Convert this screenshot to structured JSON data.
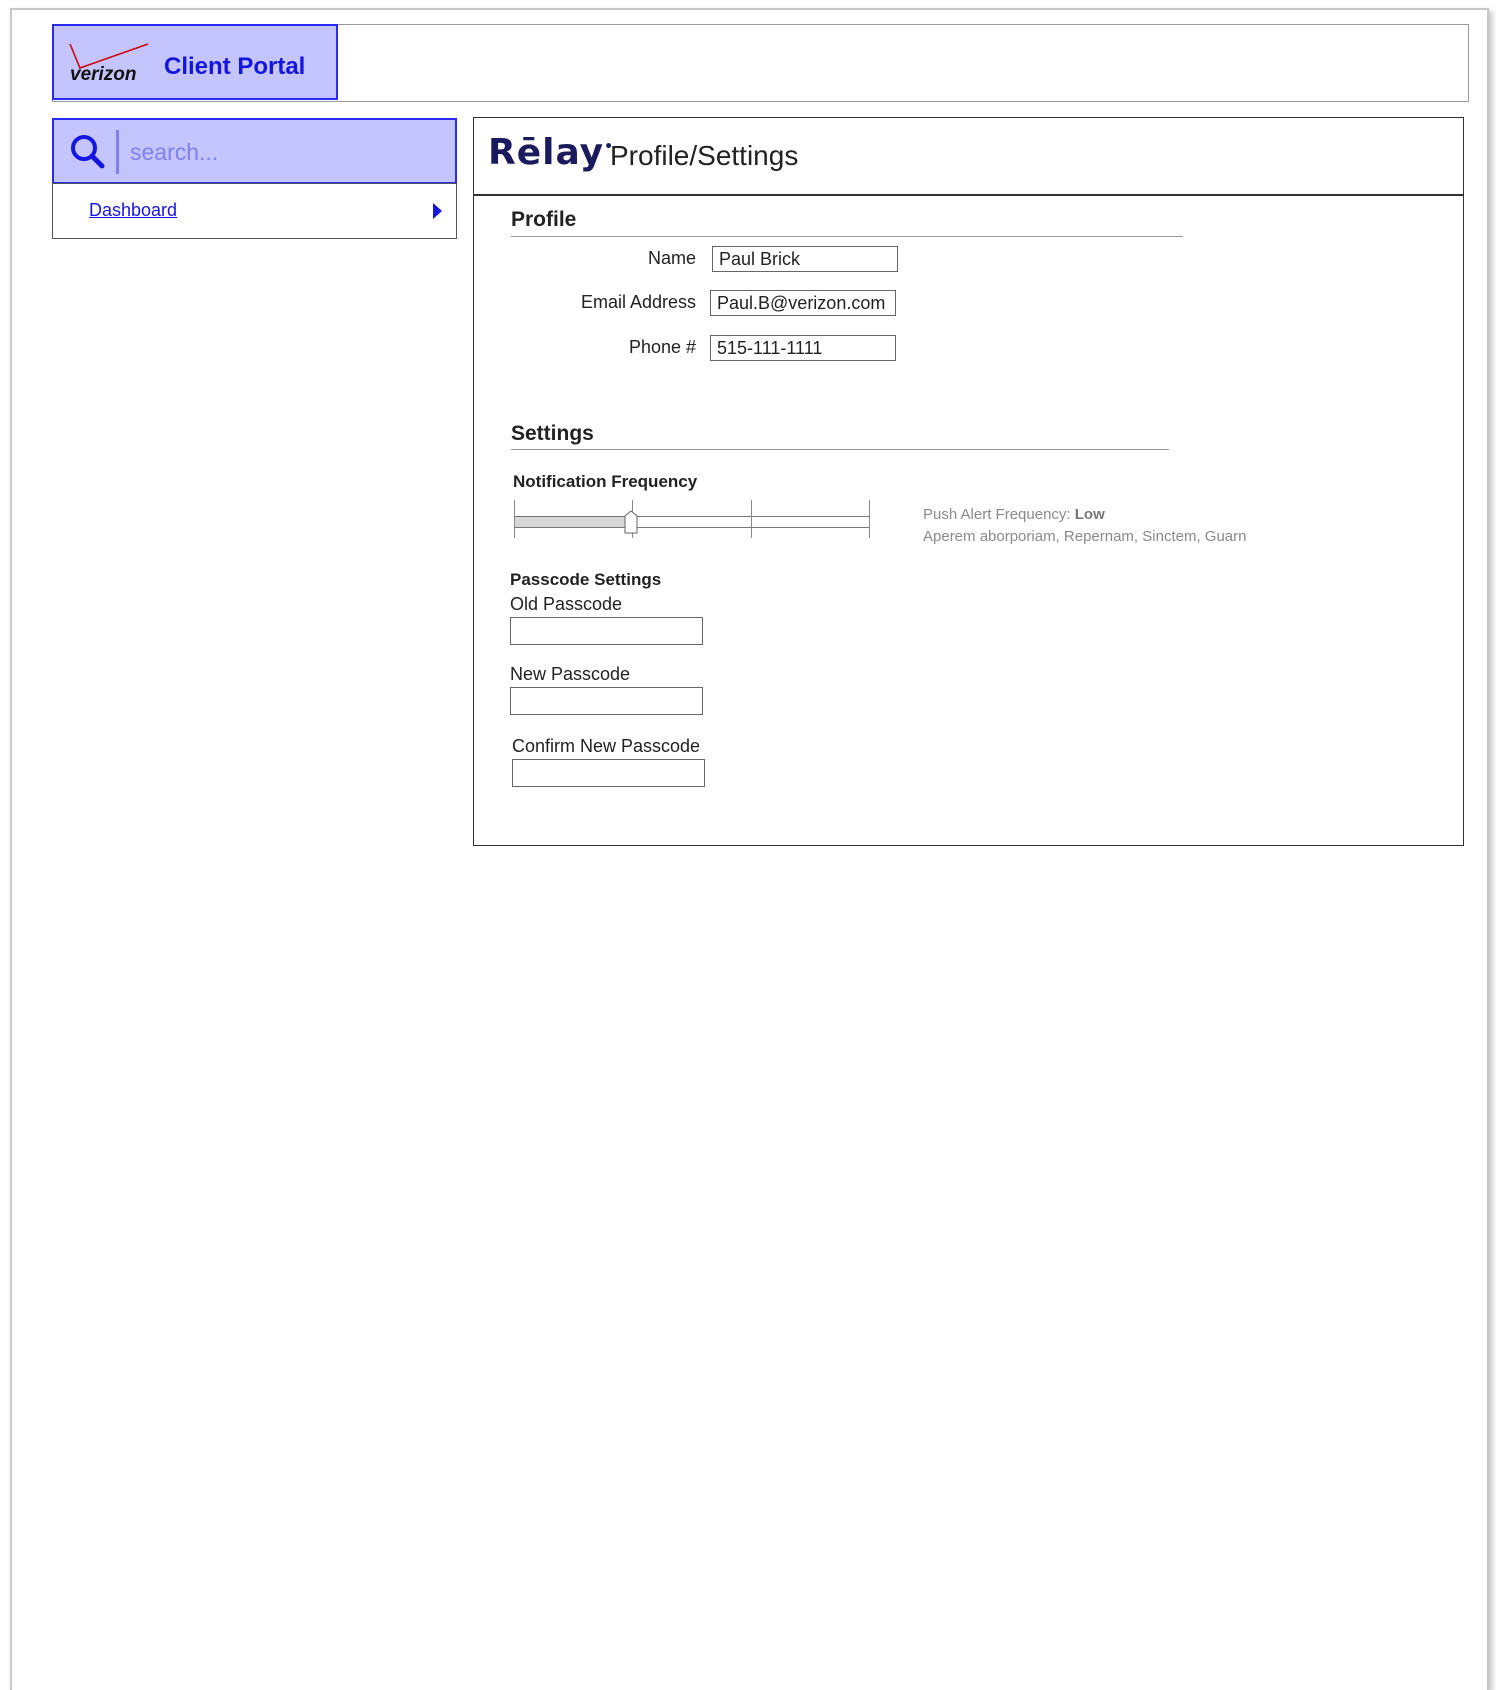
{
  "portal": {
    "brand_name": "verizon",
    "title": "Client Portal"
  },
  "search": {
    "placeholder": "search..."
  },
  "nav": {
    "items": [
      {
        "label": "Dashboard"
      }
    ]
  },
  "page": {
    "logo_text": "Rēlay",
    "title": "Profile/Settings"
  },
  "profile": {
    "heading": "Profile",
    "fields": [
      {
        "label": "Name",
        "value": "Paul Brick"
      },
      {
        "label": "Email Address",
        "value": "Paul.B@verizon.com"
      },
      {
        "label": "Phone #",
        "value": "515-111-1111"
      }
    ]
  },
  "settings": {
    "heading": "Settings",
    "notification": {
      "label": "Notification Frequency",
      "level_fraction": 0.33,
      "tick_count": 4,
      "info_prefix": "Push Alert Frequency: ",
      "info_value": "Low",
      "info_detail": "Aperem aborporiam, Repernam, Sinctem, Guarn"
    },
    "passcode": {
      "heading": "Passcode Settings",
      "old_label": "Old Passcode",
      "new_label": "New Passcode",
      "confirm_label": "Confirm New Passcode"
    }
  },
  "colors": {
    "accent": "#1515e0",
    "brand_bg": "#c4c4ff",
    "verizon_red": "#cd040b"
  }
}
